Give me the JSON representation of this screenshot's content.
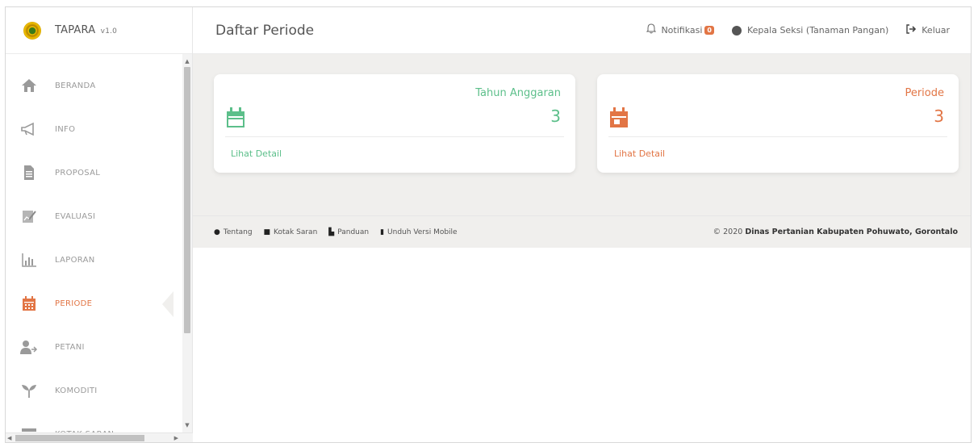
{
  "brand": {
    "name": "TAPARA",
    "version": "v1.0"
  },
  "header": {
    "title": "Daftar Periode",
    "notif_label": "Notifikasi",
    "notif_count": "0",
    "user_label": "Kepala Seksi (Tanaman Pangan)",
    "logout_label": "Keluar"
  },
  "sidebar": {
    "items": [
      {
        "label": "BERANDA",
        "icon": "home-icon"
      },
      {
        "label": "INFO",
        "icon": "megaphone-icon"
      },
      {
        "label": "PROPOSAL",
        "icon": "document-icon"
      },
      {
        "label": "EVALUASI",
        "icon": "chart-pen-icon"
      },
      {
        "label": "LAPORAN",
        "icon": "bar-chart-icon"
      },
      {
        "label": "PERIODE",
        "icon": "calendar-icon",
        "active": true
      },
      {
        "label": "PETANI",
        "icon": "users-icon"
      },
      {
        "label": "KOMODITI",
        "icon": "sprout-icon"
      },
      {
        "label": "KOTAK SARAN",
        "icon": "box-icon"
      }
    ]
  },
  "cards": [
    {
      "title": "Tahun Anggaran",
      "value": "3",
      "link": "Lihat Detail",
      "color": "#5cbf8a"
    },
    {
      "title": "Periode",
      "value": "3",
      "link": "Lihat Detail",
      "color": "#e27545"
    }
  ],
  "footer": {
    "links": [
      "Tentang",
      "Kotak Saran",
      "Panduan",
      "Unduh Versi Mobile"
    ],
    "copyright_prefix": "© 2020",
    "copyright_org": "Dinas Pertanian Kabupaten Pohuwato, Gorontalo"
  },
  "colors": {
    "accent": "#e27545",
    "green": "#5cbf8a",
    "background": "#f0efed"
  }
}
